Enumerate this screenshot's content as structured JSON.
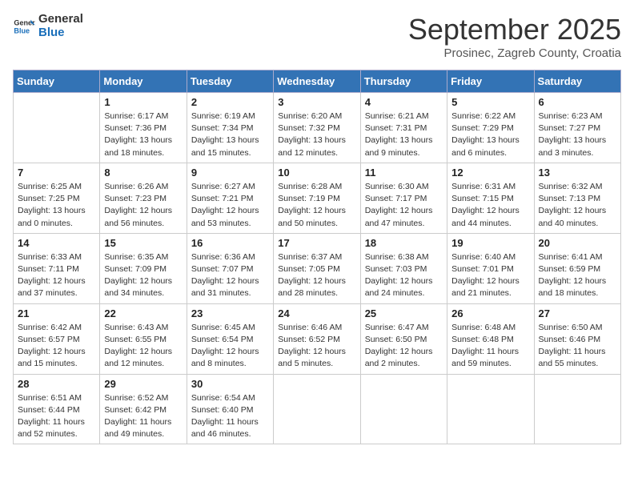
{
  "header": {
    "logo_general": "General",
    "logo_blue": "Blue",
    "month_title": "September 2025",
    "subtitle": "Prosinec, Zagreb County, Croatia"
  },
  "weekdays": [
    "Sunday",
    "Monday",
    "Tuesday",
    "Wednesday",
    "Thursday",
    "Friday",
    "Saturday"
  ],
  "weeks": [
    [
      {
        "day": "",
        "sunrise": "",
        "sunset": "",
        "daylight": ""
      },
      {
        "day": "1",
        "sunrise": "Sunrise: 6:17 AM",
        "sunset": "Sunset: 7:36 PM",
        "daylight": "Daylight: 13 hours and 18 minutes."
      },
      {
        "day": "2",
        "sunrise": "Sunrise: 6:19 AM",
        "sunset": "Sunset: 7:34 PM",
        "daylight": "Daylight: 13 hours and 15 minutes."
      },
      {
        "day": "3",
        "sunrise": "Sunrise: 6:20 AM",
        "sunset": "Sunset: 7:32 PM",
        "daylight": "Daylight: 13 hours and 12 minutes."
      },
      {
        "day": "4",
        "sunrise": "Sunrise: 6:21 AM",
        "sunset": "Sunset: 7:31 PM",
        "daylight": "Daylight: 13 hours and 9 minutes."
      },
      {
        "day": "5",
        "sunrise": "Sunrise: 6:22 AM",
        "sunset": "Sunset: 7:29 PM",
        "daylight": "Daylight: 13 hours and 6 minutes."
      },
      {
        "day": "6",
        "sunrise": "Sunrise: 6:23 AM",
        "sunset": "Sunset: 7:27 PM",
        "daylight": "Daylight: 13 hours and 3 minutes."
      }
    ],
    [
      {
        "day": "7",
        "sunrise": "Sunrise: 6:25 AM",
        "sunset": "Sunset: 7:25 PM",
        "daylight": "Daylight: 13 hours and 0 minutes."
      },
      {
        "day": "8",
        "sunrise": "Sunrise: 6:26 AM",
        "sunset": "Sunset: 7:23 PM",
        "daylight": "Daylight: 12 hours and 56 minutes."
      },
      {
        "day": "9",
        "sunrise": "Sunrise: 6:27 AM",
        "sunset": "Sunset: 7:21 PM",
        "daylight": "Daylight: 12 hours and 53 minutes."
      },
      {
        "day": "10",
        "sunrise": "Sunrise: 6:28 AM",
        "sunset": "Sunset: 7:19 PM",
        "daylight": "Daylight: 12 hours and 50 minutes."
      },
      {
        "day": "11",
        "sunrise": "Sunrise: 6:30 AM",
        "sunset": "Sunset: 7:17 PM",
        "daylight": "Daylight: 12 hours and 47 minutes."
      },
      {
        "day": "12",
        "sunrise": "Sunrise: 6:31 AM",
        "sunset": "Sunset: 7:15 PM",
        "daylight": "Daylight: 12 hours and 44 minutes."
      },
      {
        "day": "13",
        "sunrise": "Sunrise: 6:32 AM",
        "sunset": "Sunset: 7:13 PM",
        "daylight": "Daylight: 12 hours and 40 minutes."
      }
    ],
    [
      {
        "day": "14",
        "sunrise": "Sunrise: 6:33 AM",
        "sunset": "Sunset: 7:11 PM",
        "daylight": "Daylight: 12 hours and 37 minutes."
      },
      {
        "day": "15",
        "sunrise": "Sunrise: 6:35 AM",
        "sunset": "Sunset: 7:09 PM",
        "daylight": "Daylight: 12 hours and 34 minutes."
      },
      {
        "day": "16",
        "sunrise": "Sunrise: 6:36 AM",
        "sunset": "Sunset: 7:07 PM",
        "daylight": "Daylight: 12 hours and 31 minutes."
      },
      {
        "day": "17",
        "sunrise": "Sunrise: 6:37 AM",
        "sunset": "Sunset: 7:05 PM",
        "daylight": "Daylight: 12 hours and 28 minutes."
      },
      {
        "day": "18",
        "sunrise": "Sunrise: 6:38 AM",
        "sunset": "Sunset: 7:03 PM",
        "daylight": "Daylight: 12 hours and 24 minutes."
      },
      {
        "day": "19",
        "sunrise": "Sunrise: 6:40 AM",
        "sunset": "Sunset: 7:01 PM",
        "daylight": "Daylight: 12 hours and 21 minutes."
      },
      {
        "day": "20",
        "sunrise": "Sunrise: 6:41 AM",
        "sunset": "Sunset: 6:59 PM",
        "daylight": "Daylight: 12 hours and 18 minutes."
      }
    ],
    [
      {
        "day": "21",
        "sunrise": "Sunrise: 6:42 AM",
        "sunset": "Sunset: 6:57 PM",
        "daylight": "Daylight: 12 hours and 15 minutes."
      },
      {
        "day": "22",
        "sunrise": "Sunrise: 6:43 AM",
        "sunset": "Sunset: 6:55 PM",
        "daylight": "Daylight: 12 hours and 12 minutes."
      },
      {
        "day": "23",
        "sunrise": "Sunrise: 6:45 AM",
        "sunset": "Sunset: 6:54 PM",
        "daylight": "Daylight: 12 hours and 8 minutes."
      },
      {
        "day": "24",
        "sunrise": "Sunrise: 6:46 AM",
        "sunset": "Sunset: 6:52 PM",
        "daylight": "Daylight: 12 hours and 5 minutes."
      },
      {
        "day": "25",
        "sunrise": "Sunrise: 6:47 AM",
        "sunset": "Sunset: 6:50 PM",
        "daylight": "Daylight: 12 hours and 2 minutes."
      },
      {
        "day": "26",
        "sunrise": "Sunrise: 6:48 AM",
        "sunset": "Sunset: 6:48 PM",
        "daylight": "Daylight: 11 hours and 59 minutes."
      },
      {
        "day": "27",
        "sunrise": "Sunrise: 6:50 AM",
        "sunset": "Sunset: 6:46 PM",
        "daylight": "Daylight: 11 hours and 55 minutes."
      }
    ],
    [
      {
        "day": "28",
        "sunrise": "Sunrise: 6:51 AM",
        "sunset": "Sunset: 6:44 PM",
        "daylight": "Daylight: 11 hours and 52 minutes."
      },
      {
        "day": "29",
        "sunrise": "Sunrise: 6:52 AM",
        "sunset": "Sunset: 6:42 PM",
        "daylight": "Daylight: 11 hours and 49 minutes."
      },
      {
        "day": "30",
        "sunrise": "Sunrise: 6:54 AM",
        "sunset": "Sunset: 6:40 PM",
        "daylight": "Daylight: 11 hours and 46 minutes."
      },
      {
        "day": "",
        "sunrise": "",
        "sunset": "",
        "daylight": ""
      },
      {
        "day": "",
        "sunrise": "",
        "sunset": "",
        "daylight": ""
      },
      {
        "day": "",
        "sunrise": "",
        "sunset": "",
        "daylight": ""
      },
      {
        "day": "",
        "sunrise": "",
        "sunset": "",
        "daylight": ""
      }
    ]
  ]
}
